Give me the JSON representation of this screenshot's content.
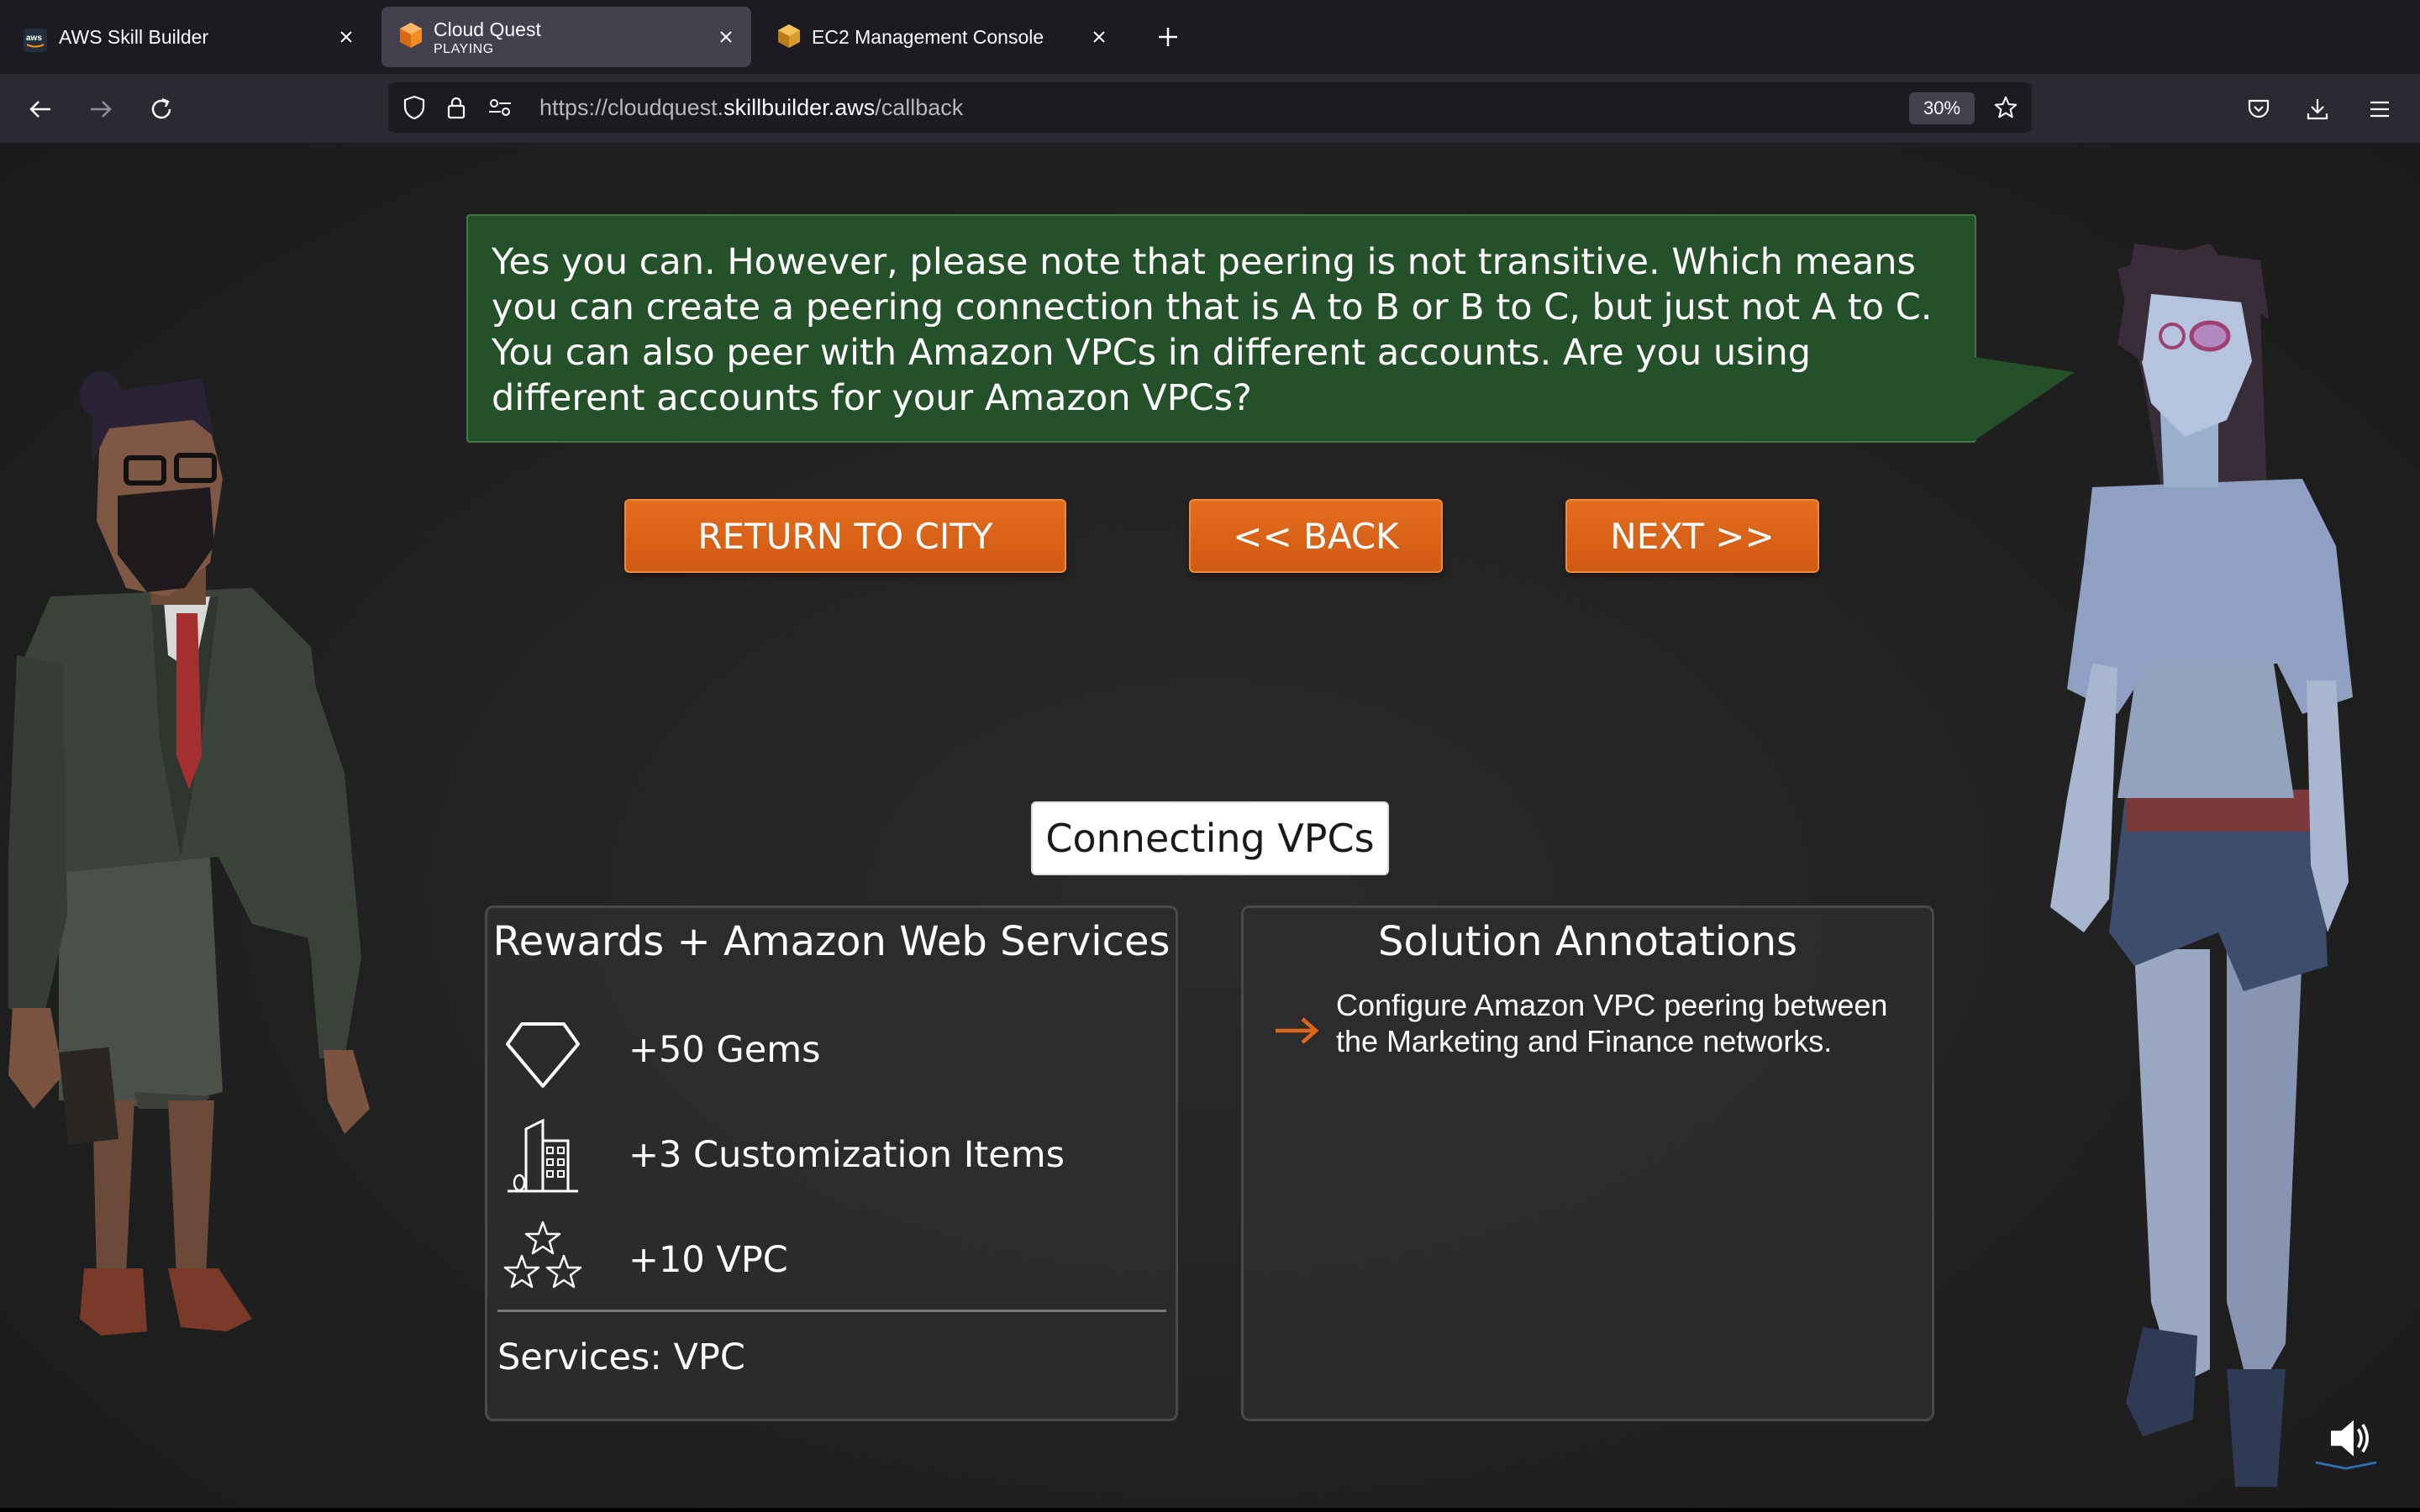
{
  "browser": {
    "tabs": [
      {
        "title": "AWS Skill Builder",
        "favicon": "aws-icon",
        "active": false
      },
      {
        "title": "Cloud Quest",
        "subtitle": "PLAYING",
        "favicon": "cloud-quest-cube-icon",
        "active": true
      },
      {
        "title": "EC2 Management Console",
        "favicon": "ec2-cube-icon",
        "active": false
      }
    ],
    "url_prefix": "https://cloudquest.",
    "url_domain": "skillbuilder.aws",
    "url_path": "/callback",
    "zoom": "30%"
  },
  "dialog": {
    "text": "Yes you can. However, please note that peering is not transitive. Which means you can create a peering connection that is A to B or B to C, but just not A to C. You can also peer with Amazon VPCs in different accounts. Are you using different accounts for your Amazon VPCs?"
  },
  "buttons": {
    "return": "RETURN TO CITY",
    "back": "<< BACK",
    "next": "NEXT >>"
  },
  "mission": {
    "title": "Connecting VPCs"
  },
  "rewards": {
    "heading": "Rewards + Amazon Web Services",
    "items": [
      {
        "icon": "gem-icon",
        "label": "+50 Gems"
      },
      {
        "icon": "building-icon",
        "label": "+3 Customization Items"
      },
      {
        "icon": "stars-icon",
        "label": "+10 VPC"
      }
    ],
    "services": "Services: VPC"
  },
  "annotations": {
    "heading": "Solution Annotations",
    "items": [
      "Configure Amazon VPC peering between the Marketing and Finance networks."
    ]
  },
  "colors": {
    "dialog_bg": "#24512a",
    "button_orange": "#e0661c",
    "arrow_orange": "#e0661c"
  }
}
